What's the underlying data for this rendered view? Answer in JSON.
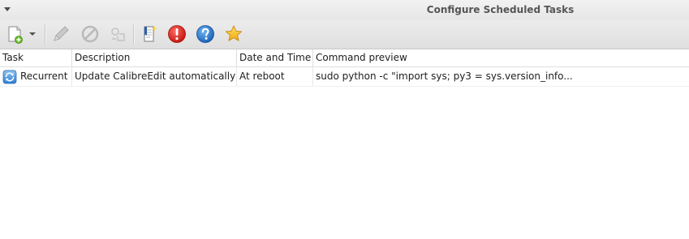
{
  "window": {
    "title": "Configure Scheduled Tasks"
  },
  "toolbar": {
    "buttons": [
      {
        "icon": "new-task-icon",
        "enabled": true
      },
      {
        "icon": "dropdown-arrow-icon",
        "enabled": true
      },
      {
        "icon": "edit-pencil-icon",
        "enabled": false
      },
      {
        "icon": "disable-icon",
        "enabled": false
      },
      {
        "icon": "run-now-icon",
        "enabled": false
      },
      {
        "icon": "output-log-icon",
        "enabled": true
      },
      {
        "icon": "warning-icon",
        "enabled": true
      },
      {
        "icon": "help-icon",
        "enabled": true
      },
      {
        "icon": "favorite-star-icon",
        "enabled": true
      }
    ]
  },
  "table": {
    "columns": [
      "Task",
      "Description",
      "Date and Time",
      "Command preview"
    ],
    "rows": [
      {
        "icon": "recurrent-icon",
        "task": "Recurrent",
        "description": "Update CalibreEdit automatically",
        "date_time": "At reboot",
        "command": "sudo python -c \"import sys; py3 = sys.version_info..."
      }
    ]
  },
  "colors": {
    "accent_blue": "#2d7fd3",
    "warning_red": "#d9201c",
    "star_gold": "#f2b81c"
  }
}
